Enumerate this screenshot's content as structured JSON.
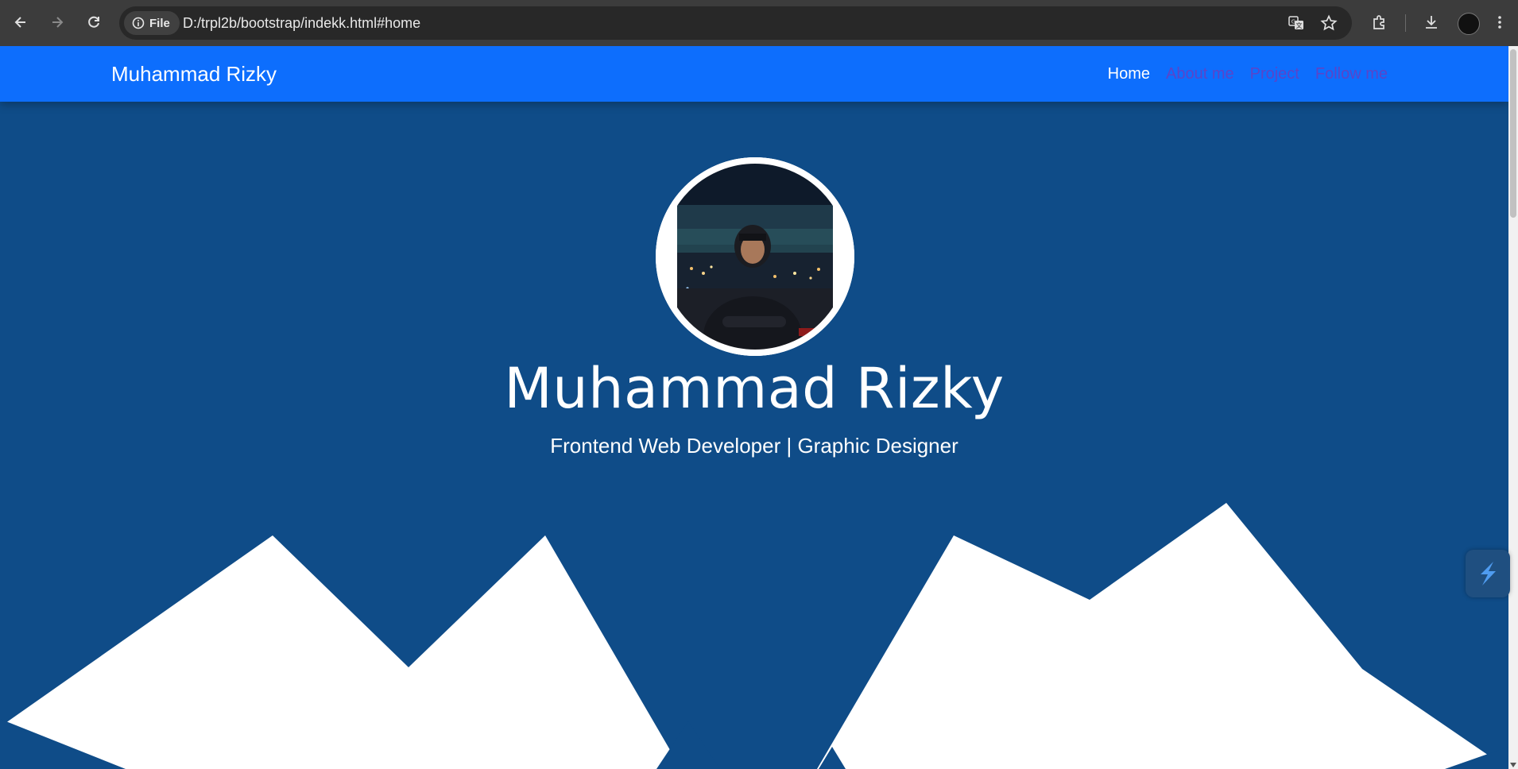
{
  "browser": {
    "file_chip_label": "File",
    "url": "D:/trpl2b/bootstrap/indekk.html#home"
  },
  "navbar": {
    "brand": "Muhammad Rizky",
    "links": [
      {
        "label": "Home",
        "active": true
      },
      {
        "label": "About me",
        "active": false
      },
      {
        "label": "Project",
        "active": false
      },
      {
        "label": "Follow me",
        "active": false
      }
    ]
  },
  "hero": {
    "name": "Muhammad Rizky",
    "subtitle": "Frontend Web Developer | Graphic Designer"
  },
  "colors": {
    "navbar_bg": "#0d6efd",
    "hero_bg": "#0f4c88",
    "inactive_link": "#5a45c9"
  }
}
